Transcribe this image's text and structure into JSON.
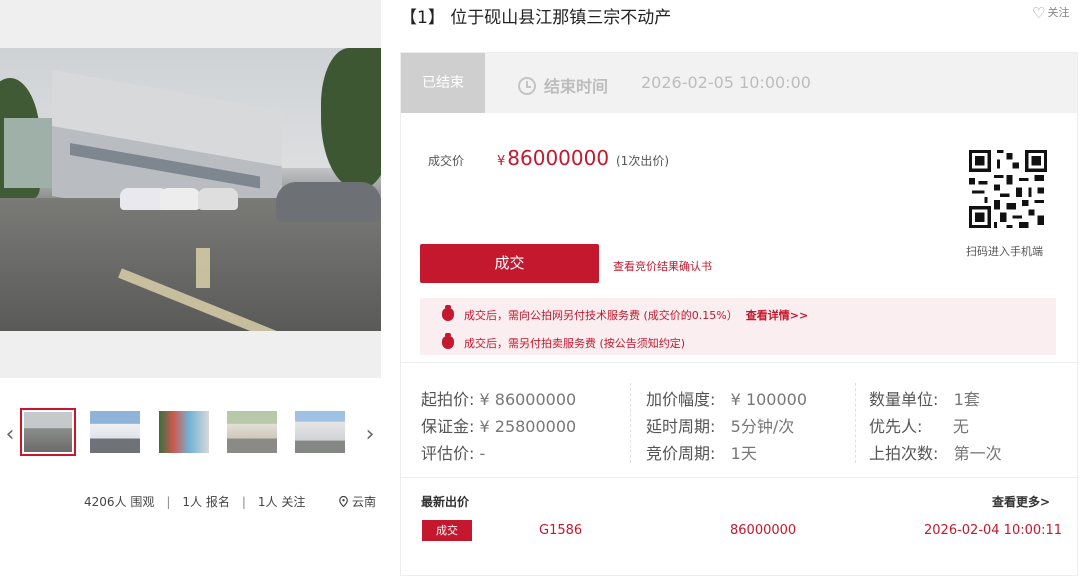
{
  "gallery": {
    "prev_icon": "chevron-left-icon",
    "next_icon": "chevron-right-icon",
    "thumb_count": 5
  },
  "stats": {
    "views": "4206人 围观",
    "signups": "1人 报名",
    "follows": "1人 关注",
    "location": "云南",
    "separator": "|"
  },
  "header": {
    "title": "【1】 位于砚山县江那镇三宗不动产",
    "follow_label": "关注",
    "follow_icon": "heart-icon"
  },
  "status": {
    "tag": "已结束",
    "end_label": "结束时间",
    "end_time": "2026-02-05 10:00:00"
  },
  "deal": {
    "price_label": "成交价",
    "currency": "¥",
    "price": "86000000",
    "bid_count": "(1次出价)",
    "button": "成交",
    "confirm_link": "查看竞价结果确认书",
    "qr_caption": "扫码进入手机端"
  },
  "notices": [
    {
      "text": "成交后，需向公拍网另付技术服务费 (成交价的0.15%）",
      "link": "查看详情>>"
    },
    {
      "text": "成交后，需另付拍卖服务费 (按公告须知约定)",
      "link": ""
    }
  ],
  "info": {
    "start_price_label": "起拍价:",
    "start_price": "¥ 86000000",
    "deposit_label": "保证金:",
    "deposit": "¥ 25800000",
    "valuation_label": "评估价:",
    "valuation": "-",
    "increment_label": "加价幅度:",
    "increment": "¥ 100000",
    "delay_label": "延时周期:",
    "delay": "5分钟/次",
    "bid_period_label": "竞价周期:",
    "bid_period": "1天",
    "unit_label": "数量单位:",
    "unit": "1套",
    "priority_label": "优先人:",
    "priority": "无",
    "times_label": "上拍次数:",
    "times": "第一次"
  },
  "latest": {
    "title": "最新出价",
    "more": "查看更多>",
    "rows": [
      {
        "status": "成交",
        "bidder": "G1586",
        "amount": "86000000",
        "time": "2026-02-04 10:00:11"
      }
    ]
  },
  "colors": {
    "accent": "#c3182e",
    "status_gray": "#cfcfcf",
    "notice_bg": "#fbeef0"
  }
}
